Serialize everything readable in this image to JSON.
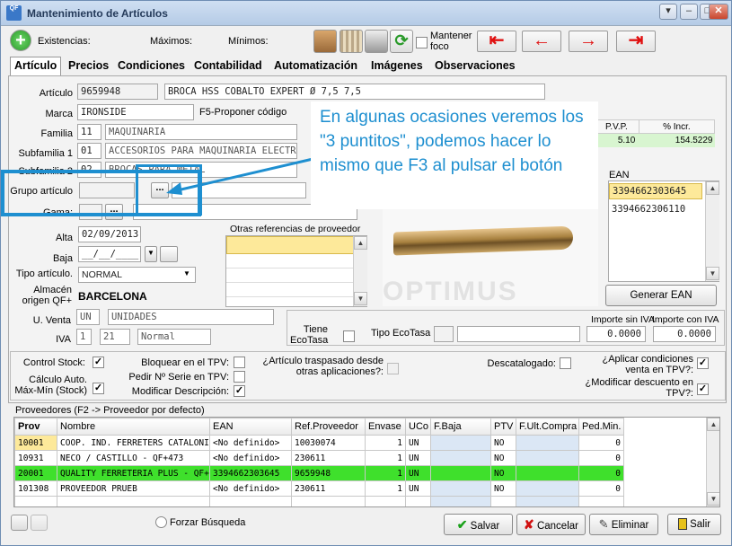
{
  "window": {
    "title": "Mantenimiento de Artículos",
    "logo": "QF"
  },
  "toolbar": {
    "existencias_label": "Existencias:",
    "maximos_label": "Máximos:",
    "minimos_label": "Mínimos:",
    "mantener_foco_label": "Mantener foco",
    "nav": [
      "⇤",
      "←",
      "→",
      "⇥"
    ]
  },
  "tabs": [
    "Artículo",
    "Precios",
    "Condiciones",
    "Contabilidad",
    "Automatización",
    "Imágenes",
    "Observaciones"
  ],
  "form": {
    "articulo_label": "Artículo",
    "articulo_code": "9659948",
    "articulo_desc": "BROCA HSS COBALTO EXPERT Ø 7,5 7,5",
    "marca_label": "Marca",
    "marca_value": "IRONSIDE",
    "marca_hint": "F5-Proponer código",
    "familia_label": "Familia",
    "familia_code": "11",
    "familia_desc": "MAQUINARIA",
    "subfamilia1_label": "Subfamilia 1",
    "subfamilia1_code": "01",
    "subfamilia1_desc": "ACCESORIOS PARA MAQUINARIA ELECTRIC",
    "subfamilia2_label": "Subfamilia 2",
    "subfamilia2_code": "02",
    "subfamilia2_desc": "BROCAS PARA METAL",
    "grupo_label": "Grupo artículo",
    "gama_label": "Gama:",
    "alta_label": "Alta",
    "alta_value": "02/09/2013",
    "baja_label": "Baja",
    "baja_value": "__/__/____",
    "tipo_label": "Tipo artículo.",
    "tipo_value": "NORMAL",
    "almacen_label": "Almacén origen QF+",
    "almacen_value": "BARCELONA",
    "uventa_label": "U. Venta",
    "uventa_code": "UN",
    "uventa_desc": "UNIDADES",
    "iva_label": "IVA",
    "iva_code": "1",
    "iva_pct": "21",
    "iva_desc": "Normal",
    "otras_ref_label": "Otras referencias de proveedor"
  },
  "pvp_table": {
    "headers": [
      "P.V.P.",
      "% Incr."
    ],
    "row": [
      "5.10",
      "154.5229"
    ]
  },
  "ean": {
    "label": "EAN",
    "items": [
      "3394662303645",
      "3394662306110"
    ],
    "button": "Generar EAN"
  },
  "ecotasa": {
    "tiene_label": "Tiene EcoTasa",
    "tipo_label": "Tipo EcoTasa",
    "sin_iva_label": "Importe sin IVA",
    "con_iva_label": "Importe con IVA",
    "sin_iva": "0.0000",
    "con_iva": "0.0000"
  },
  "options": {
    "control_stock": "Control Stock:",
    "calculo": "Cálculo Auto. Máx-Mín (Stock)",
    "bloquear": "Bloquear en el TPV:",
    "pedir_serie": "Pedir Nº Serie en TPV:",
    "modificar_desc": "Modificar Descripción:",
    "traspasado": "¿Artículo traspasado desde otras aplicaciones?:",
    "descatalogado": "Descatalogado:",
    "aplicar_cond": "¿Aplicar condiciones venta en TPV?:",
    "modificar_dto": "¿Modificar descuento en TPV?:"
  },
  "proveedores": {
    "caption": "Proveedores (F2 -> Proveedor por defecto)",
    "headers": [
      "Prov",
      "Nombre",
      "EAN",
      "Ref.Proveedor",
      "Envase",
      "UCo",
      "F.Baja",
      "PTV",
      "F.Ult.Compra",
      "Ped.Min."
    ],
    "rows": [
      [
        "10001",
        "COOP. IND. FERRETERS CATALONIA",
        "<No definido>",
        "10030074",
        "1",
        "UN",
        "",
        "NO",
        "",
        "0"
      ],
      [
        "10931",
        "NECO / CASTILLO - QF+473",
        "<No definido>",
        "230611",
        "1",
        "UN",
        "",
        "NO",
        "",
        "0"
      ],
      [
        "20001",
        "QUALITY FERRETERIA PLUS - QF+",
        "3394662303645",
        "9659948",
        "1",
        "UN",
        "",
        "NO",
        "",
        "0"
      ],
      [
        "101308",
        "PROVEEDOR PRUEB",
        "<No definido>",
        "230611",
        "1",
        "UN",
        "",
        "NO",
        "",
        "0"
      ]
    ],
    "highlight_row": 2
  },
  "footer": {
    "forzar": "Forzar Búsqueda",
    "salvar": "Salvar",
    "cancelar": "Cancelar",
    "eliminar": "Eliminar",
    "salir": "Salir"
  },
  "annotation": {
    "text": "En algunas ocasiones veremos los \"3 puntitos\", podemos hacer lo mismo que F3 al pulsar el botón"
  },
  "image": {
    "watermark": "OPTIMUS"
  },
  "colors": {
    "highlight": "#3fe02c",
    "annotation": "#1e8fd0",
    "nav_arrow": "#e01010"
  }
}
